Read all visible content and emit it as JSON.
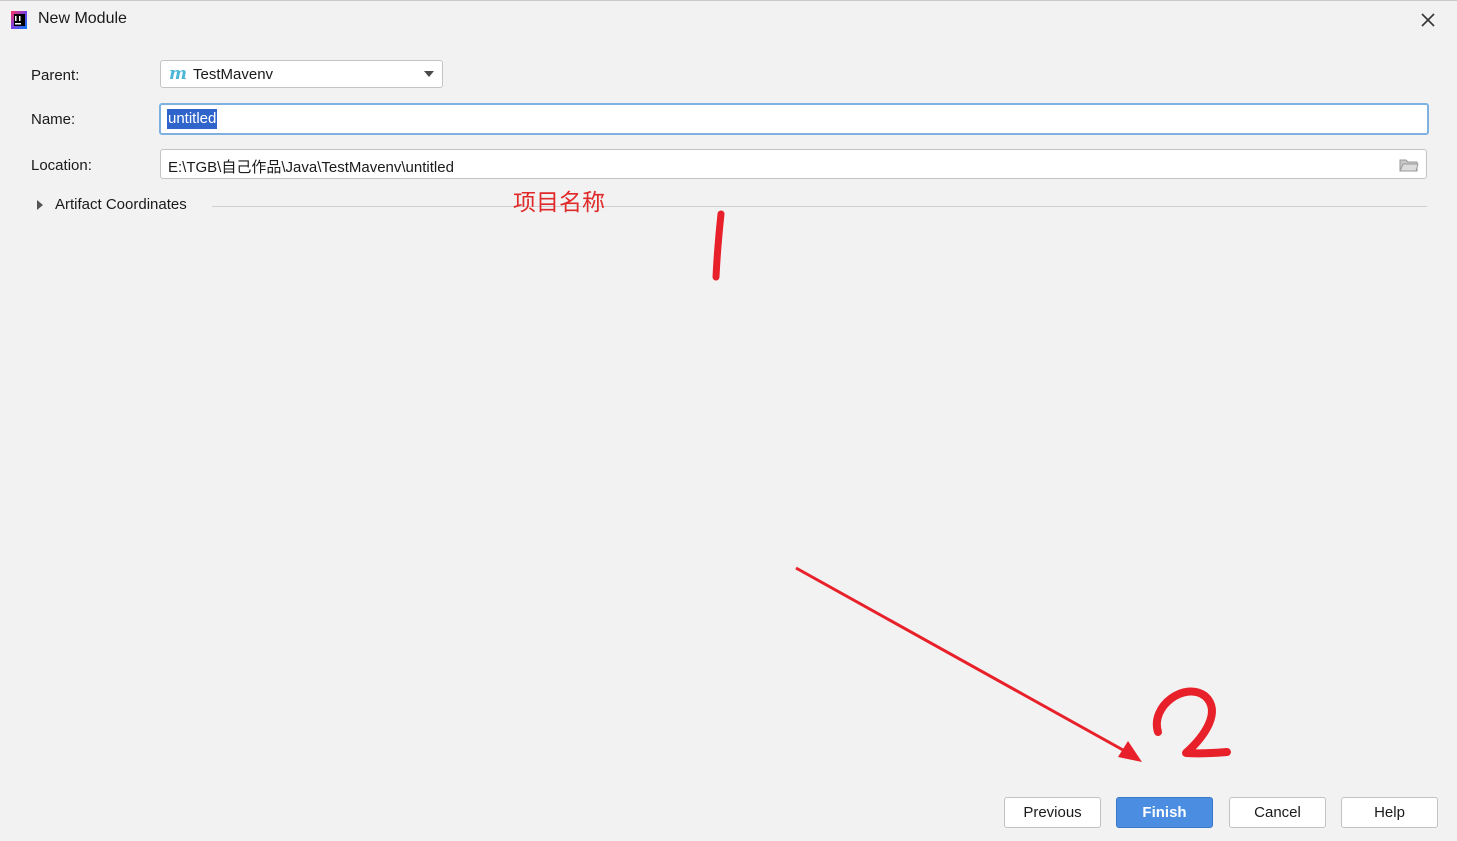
{
  "window": {
    "title": "New Module",
    "close_icon": "close-icon"
  },
  "form": {
    "parent_label": "Parent:",
    "parent_value": "TestMavenv",
    "parent_icon": "maven-icon",
    "parent_icon_glyph": "m",
    "name_label": "Name:",
    "name_value": "untitled",
    "location_label": "Location:",
    "location_value": "E:\\TGB\\自己作品\\Java\\TestMavenv\\untitled",
    "location_icon": "folder-icon"
  },
  "artifact": {
    "label": "Artifact Coordinates",
    "expanded": false
  },
  "annotation": {
    "text": "项目名称",
    "color": "#e02a2a"
  },
  "buttons": {
    "previous": "Previous",
    "finish": "Finish",
    "cancel": "Cancel",
    "help": "Help"
  },
  "colors": {
    "accent": "#4b8de0",
    "selection": "#2f65ca",
    "focus_border": "#7fb1e0",
    "maven": "#4cb6d6"
  }
}
